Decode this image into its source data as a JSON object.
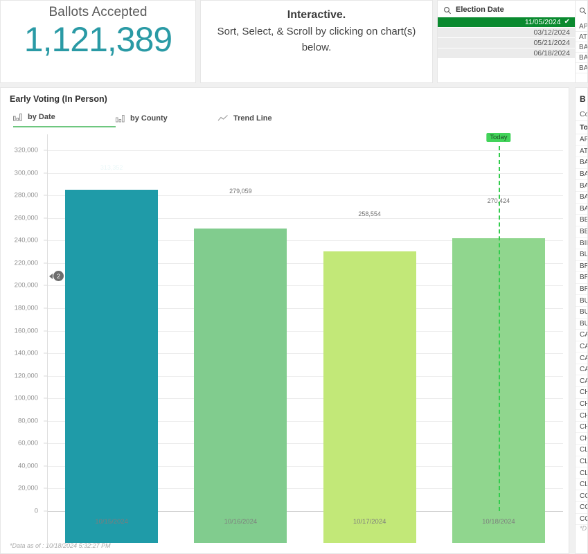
{
  "kpi": {
    "title": "Ballots Accepted",
    "value": "1,121,389",
    "accent_color": "#2a9aa5"
  },
  "info": {
    "title": "Interactive.",
    "body": "Sort, Select, & Scroll by clicking on chart(s) below."
  },
  "election_filter": {
    "title": "Election Date",
    "search_icon": "search-icon",
    "check_glyph": "✔",
    "selected_color": "#0a8a2f",
    "options": [
      {
        "label": "11/05/2024",
        "selected": true
      },
      {
        "label": "03/12/2024",
        "selected": false
      },
      {
        "label": "05/21/2024",
        "selected": false
      },
      {
        "label": "06/18/2024",
        "selected": false
      }
    ]
  },
  "chart_panel": {
    "title": "Early Voting (In Person)",
    "tabs": [
      {
        "label": "by Date",
        "icon": "bar-chart-icon",
        "active": true
      },
      {
        "label": "by County",
        "icon": "bar-chart-icon",
        "active": false
      },
      {
        "label": "Trend Line",
        "icon": "line-chart-icon",
        "active": false
      }
    ],
    "scroll_badge": "2",
    "footnote": "*Data as of : 10/18/2024 5:32:27 PM"
  },
  "chart_data": {
    "type": "bar",
    "title": "Early Voting (In Person)",
    "xlabel": "",
    "ylabel": "",
    "categories": [
      "10/15/2024",
      "10/16/2024",
      "10/17/2024",
      "10/18/2024"
    ],
    "values": [
      313352,
      279059,
      258554,
      270424
    ],
    "value_labels": [
      "313,352",
      "279,059",
      "258,554",
      "270,424"
    ],
    "bar_colors": [
      "#1f9ba8",
      "#81cc8e",
      "#c2e878",
      "#90d68e"
    ],
    "ylim": [
      0,
      328000
    ],
    "yticks": [
      0,
      20000,
      40000,
      60000,
      80000,
      100000,
      120000,
      140000,
      160000,
      180000,
      200000,
      220000,
      240000,
      260000,
      280000,
      300000,
      320000
    ],
    "ytick_labels": [
      "0",
      "20,000",
      "40,000",
      "60,000",
      "80,000",
      "100,000",
      "120,000",
      "140,000",
      "160,000",
      "180,000",
      "200,000",
      "220,000",
      "240,000",
      "260,000",
      "280,000",
      "300,000",
      "320,000"
    ],
    "grid": true,
    "legend": "none",
    "annotations": [
      {
        "type": "reference-line",
        "label": "Today",
        "at_category": "10/18/2024",
        "color": "#33cc4d",
        "style": "dashed"
      }
    ]
  },
  "right_filter": {
    "search_icon": "search-icon",
    "rows": [
      "APP",
      "ATH",
      "BAC",
      "BAL",
      "BAI"
    ]
  },
  "right_table": {
    "title": "B",
    "col_county": "Co",
    "col_total": "Tot",
    "rows": [
      "AP",
      "ATI",
      "BA",
      "BA",
      "BA",
      "BA",
      "BA",
      "BE",
      "BE",
      "BIE",
      "BL",
      "BR",
      "BR",
      "BR",
      "BU",
      "BU",
      "BU",
      "CA",
      "CA",
      "CA",
      "CA",
      "CA",
      "CH",
      "CH",
      "CH",
      "CH",
      "CH",
      "CL",
      "CL",
      "CL",
      "CL",
      "CO",
      "CO",
      "CO"
    ],
    "footnote": "*D"
  }
}
